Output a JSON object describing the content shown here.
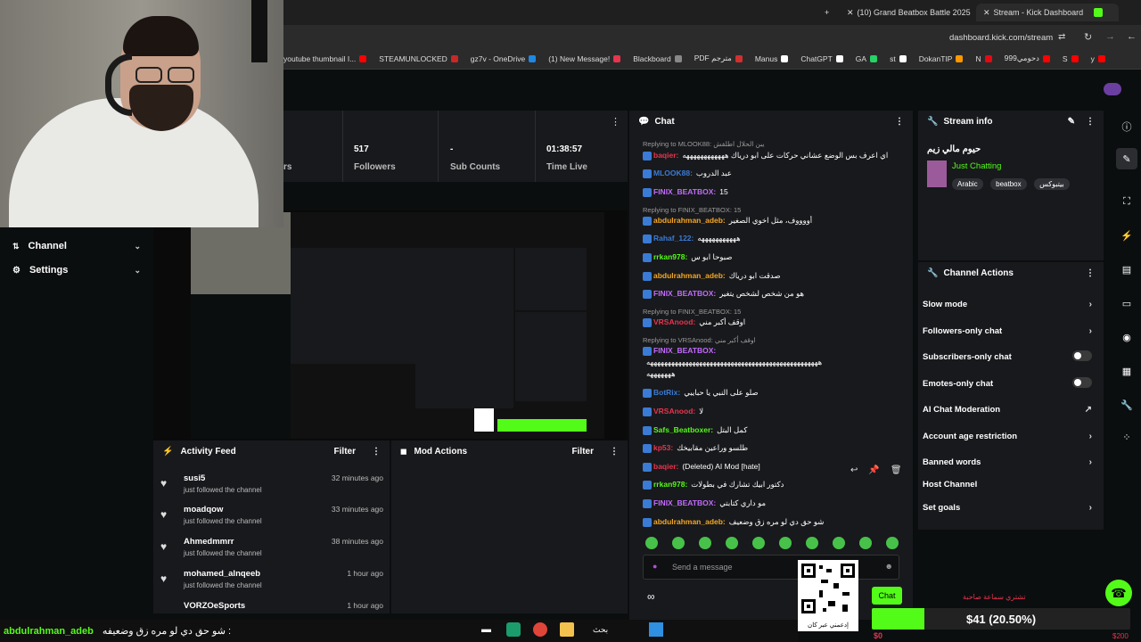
{
  "browser": {
    "tabs": [
      {
        "label": "(10) Grand Beatbox Battle 2025",
        "active": false
      },
      {
        "label": "Stream - Kick Dashboard",
        "active": true
      }
    ],
    "url": "dashboard.kick.com/stream",
    "bookmarks": [
      {
        "label": "youtube thumbnail I...",
        "color": "#ff0000"
      },
      {
        "label": "STEAMUNLOCKED",
        "color": "#c82828"
      },
      {
        "label": "gz7v - OneDrive",
        "color": "#1e88e5"
      },
      {
        "label": "(1) New Message!",
        "color": "#e8344d"
      },
      {
        "label": "Blackboard",
        "color": "#888888"
      },
      {
        "label": "PDF مترجم",
        "color": "#d32f2f"
      },
      {
        "label": "Manus",
        "color": "#ffffff"
      },
      {
        "label": "ChatGPT",
        "color": "#ffffff"
      },
      {
        "label": "GA",
        "color": "#25d366"
      },
      {
        "label": "st",
        "color": "#ffffff"
      },
      {
        "label": "DokanTIP",
        "color": "#ff9800"
      },
      {
        "label": "N",
        "color": "#e50914"
      },
      {
        "label": "999دحومي",
        "color": "#ff0000"
      },
      {
        "label": "S",
        "color": "#ff0000"
      },
      {
        "label": "y",
        "color": "#ff0000"
      }
    ]
  },
  "sidebar": {
    "items": [
      {
        "label": "Channel",
        "icon": "channel-icon"
      },
      {
        "label": "Settings",
        "icon": "gear-icon"
      }
    ]
  },
  "stats": {
    "partial_label": "rs",
    "followers_value": "517",
    "followers_label": "Followers",
    "subs_value": "-",
    "subs_label": "Sub Counts",
    "time_value": "01:38:57",
    "time_label": "Time Live"
  },
  "activity_feed": {
    "title": "Activity Feed",
    "filter": "Filter",
    "items": [
      {
        "name": "susi5",
        "sub": "just followed the channel",
        "time": "32 minutes ago"
      },
      {
        "name": "moadqow",
        "sub": "just followed the channel",
        "time": "33 minutes ago"
      },
      {
        "name": "Ahmedmmrr",
        "sub": "just followed the channel",
        "time": "38 minutes ago"
      },
      {
        "name": "mohamed_alnqeeb",
        "sub": "just followed the channel",
        "time": "1 hour ago"
      },
      {
        "name": "VORZOeSports",
        "sub": "",
        "time": "1 hour ago"
      }
    ]
  },
  "mod_actions": {
    "title": "Mod Actions",
    "filter": "Filter"
  },
  "chat": {
    "title": "Chat",
    "input_placeholder": "Send a message",
    "send_label": "Chat",
    "messages": [
      {
        "reply": "Replying to MLOOK88: يبن الحلال اطلقش",
        "user": "",
        "text": "",
        "color": "#9a9a9a"
      },
      {
        "reply": "",
        "user": "baqier:",
        "text": "اي اعرف بس الوضع عشاني حركات على ابو درياك ههههههههههههه",
        "color": "#e8344d"
      },
      {
        "reply": "",
        "user": "MLOOK88:",
        "text": "عبد الدروب",
        "color": "#3a7bd5"
      },
      {
        "reply": "",
        "user": "FINIX_BEATBOX:",
        "text": "15",
        "color": "#c36bff"
      },
      {
        "reply": "Replying to FINIX_BEATBOX: 15",
        "user": "",
        "text": "",
        "color": "#9a9a9a"
      },
      {
        "reply": "",
        "user": "abdulrahman_adeb:",
        "text": "أووووف، مثل اخوي الصغير",
        "color": "#f5a623"
      },
      {
        "reply": "",
        "user": "Rahaf_122:",
        "text": "هههههههههههه",
        "color": "#3a7bd5"
      },
      {
        "reply": "",
        "user": "rrkan978:",
        "text": "صبوحا ابو س",
        "color": "#53fc18"
      },
      {
        "reply": "",
        "user": "abdulrahman_adeb:",
        "text": "صدقت ابو درياك",
        "color": "#f5a623"
      },
      {
        "reply": "",
        "user": "FINIX_BEATBOX:",
        "text": "هو من شخص لشخص يتغير",
        "color": "#c36bff"
      },
      {
        "reply": "Replying to FINIX_BEATBOX: 15",
        "user": "",
        "text": "",
        "color": "#9a9a9a"
      },
      {
        "reply": "",
        "user": "VRSAnood:",
        "text": "اوقف أكبر مني",
        "color": "#e8344d"
      },
      {
        "reply": "Replying to VRSAnood: اوقف أكبر مني",
        "user": "",
        "text": "",
        "color": "#9a9a9a"
      },
      {
        "reply": "",
        "user": "FINIX_BEATBOX:",
        "text": "",
        "color": "#c36bff"
      },
      {
        "reply": "",
        "user": "",
        "text": "هههههههههههههههههههههههههههههههههههههههههههههههههه",
        "color": "#ffffff"
      },
      {
        "reply": "",
        "user": "",
        "text": "هههههههه",
        "color": "#ffffff"
      },
      {
        "reply": "",
        "user": "BotRix:",
        "text": "صلو على النبي يا حبايبي",
        "color": "#3a7bd5"
      },
      {
        "reply": "",
        "user": "VRSAnood:",
        "text": "لا",
        "color": "#e8344d"
      },
      {
        "reply": "",
        "user": "Safs_Beatboxer:",
        "text": "كمل البتل",
        "color": "#53fc18"
      },
      {
        "reply": "",
        "user": "kp53:",
        "text": "طلسو وراعين مقابيخك",
        "color": "#e8344d"
      },
      {
        "reply": "",
        "user": "baqier:",
        "text": "(Deleted) AI Mod [hate]",
        "color": "#e8344d"
      },
      {
        "reply": "",
        "user": "rrkan978:",
        "text": "دكتور ابيك تشارك في بطولات",
        "color": "#53fc18"
      },
      {
        "reply": "",
        "user": "FINIX_BEATBOX:",
        "text": "مو داري كتابتي",
        "color": "#c36bff"
      },
      {
        "reply": "",
        "user": "abdulrahman_adeb:",
        "text": "شو حق دي لو مره زق وضعيف",
        "color": "#f5a623"
      }
    ]
  },
  "stream_info": {
    "title": "Stream info",
    "stream_title": "حيوم مالي زيم",
    "category": "Just Chatting",
    "tags": [
      "Arabic",
      "beatbox",
      "بيتبوكس"
    ]
  },
  "channel_actions": {
    "title": "Channel Actions",
    "items": [
      {
        "label": "Slow mode",
        "control": "chevron"
      },
      {
        "label": "Followers-only chat",
        "control": "chevron"
      },
      {
        "label": "Subscribers-only chat",
        "control": "toggle"
      },
      {
        "label": "Emotes-only chat",
        "control": "toggle"
      },
      {
        "label": "AI Chat Moderation",
        "control": "external"
      },
      {
        "label": "Account age restriction",
        "control": "chevron"
      },
      {
        "label": "Banned words",
        "control": "chevron"
      },
      {
        "label": "Host Channel",
        "control": "none"
      },
      {
        "label": "Set goals",
        "control": "chevron"
      }
    ]
  },
  "overlay": {
    "ticker_user": "abdulrahman_adeb",
    "ticker_text": "شو حق دي لو مره زق وضعيفه :",
    "taskbar_search": "بحث",
    "qr_caption": "إدعمني عبر كان",
    "goal_label": "$41 (20.50%)",
    "goal_progress": 0.205,
    "goal_min": "$0",
    "goal_max": "$200",
    "goal_top_text": "تشتري سماعة صاحبة"
  },
  "colors": {
    "kick_green": "#53fc18",
    "panel_bg": "#18191c",
    "page_bg": "#0b0e0f"
  }
}
